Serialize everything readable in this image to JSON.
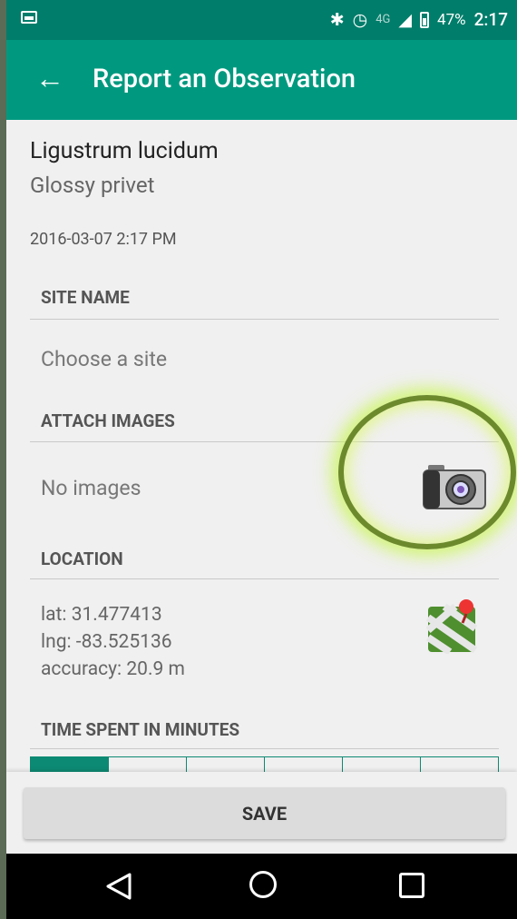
{
  "status_bar": {
    "battery_percent": "47%",
    "time": "2:17",
    "icons": [
      "bluetooth-icon",
      "alarm-icon",
      "network-icon",
      "signal-icon",
      "battery-icon"
    ]
  },
  "app_bar": {
    "back_icon": "back-arrow-icon",
    "title": "Report an Observation"
  },
  "observation": {
    "scientific_name": "Ligustrum lucidum",
    "common_name": "Glossy privet",
    "datetime": "2016-03-07 2:17 PM"
  },
  "site": {
    "label": "SITE NAME",
    "value": "Choose a site"
  },
  "images": {
    "label": "ATTACH IMAGES",
    "value": "No images",
    "icon": "camera-icon"
  },
  "location": {
    "label": "LOCATION",
    "lat": "lat:  31.477413",
    "lng": "lng: -83.525136",
    "accuracy": "accuracy:  20.9 m",
    "icon": "map-pin-icon"
  },
  "time_spent": {
    "label": "TIME SPENT IN MINUTES"
  },
  "actions": {
    "save_label": "SAVE"
  },
  "nav": {
    "back_icon": "nav-back-icon",
    "home_icon": "nav-home-icon",
    "recent_icon": "nav-recent-icon"
  }
}
